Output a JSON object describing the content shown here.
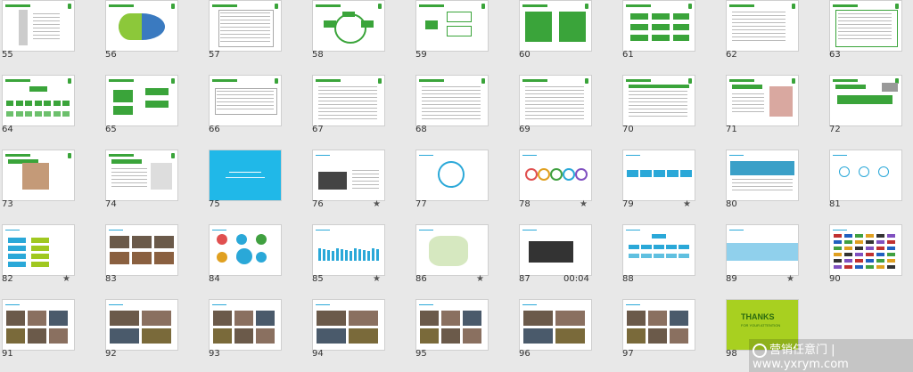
{
  "slides": [
    {
      "n": "55",
      "type": "figure"
    },
    {
      "n": "56",
      "type": "pie"
    },
    {
      "n": "57",
      "type": "table"
    },
    {
      "n": "58",
      "type": "cycle"
    },
    {
      "n": "59",
      "type": "flow"
    },
    {
      "n": "60",
      "type": "greenblocks"
    },
    {
      "n": "61",
      "type": "greenboxes"
    },
    {
      "n": "62",
      "type": "textlist"
    },
    {
      "n": "63",
      "type": "textbox"
    },
    {
      "n": "64",
      "type": "org"
    },
    {
      "n": "65",
      "type": "flow2"
    },
    {
      "n": "66",
      "type": "table2"
    },
    {
      "n": "67",
      "type": "text"
    },
    {
      "n": "68",
      "type": "text"
    },
    {
      "n": "69",
      "type": "text"
    },
    {
      "n": "70",
      "type": "tabletext"
    },
    {
      "n": "71",
      "type": "photoR"
    },
    {
      "n": "72",
      "type": "photoArrow"
    },
    {
      "n": "73",
      "type": "photoface"
    },
    {
      "n": "74",
      "type": "photoside"
    },
    {
      "n": "75",
      "type": "blue"
    },
    {
      "n": "76",
      "type": "people",
      "star": "★"
    },
    {
      "n": "77",
      "type": "circle"
    },
    {
      "n": "78",
      "type": "circles",
      "star": "★"
    },
    {
      "n": "79",
      "type": "bluesteps",
      "star": "★"
    },
    {
      "n": "80",
      "type": "banner"
    },
    {
      "n": "81",
      "type": "icons"
    },
    {
      "n": "82",
      "type": "bars",
      "star": "★"
    },
    {
      "n": "83",
      "type": "photos"
    },
    {
      "n": "84",
      "type": "bubbles"
    },
    {
      "n": "85",
      "type": "barchart",
      "star": "★"
    },
    {
      "n": "86",
      "type": "map",
      "star": "★"
    },
    {
      "n": "87",
      "type": "group",
      "duration": "00:04"
    },
    {
      "n": "88",
      "type": "tree"
    },
    {
      "n": "89",
      "type": "water",
      "star": "★"
    },
    {
      "n": "90",
      "type": "logos"
    },
    {
      "n": "91",
      "type": "photos2"
    },
    {
      "n": "92",
      "type": "photos3"
    },
    {
      "n": "93",
      "type": "photos4"
    },
    {
      "n": "94",
      "type": "photos5"
    },
    {
      "n": "95",
      "type": "photos6"
    },
    {
      "n": "96",
      "type": "photos7"
    },
    {
      "n": "97",
      "type": "photos8"
    },
    {
      "n": "98",
      "type": "thanks",
      "title": "THANKS",
      "subtitle": "FOR YOUR ATTENTION"
    }
  ],
  "watermark": {
    "text": "营销任意门 | www.yxrym.com"
  },
  "colors": {
    "accent": "#3aa43a",
    "blue": "#20b8e8",
    "thanks_bg": "#a8d020",
    "bg": "#e8e8e8"
  }
}
